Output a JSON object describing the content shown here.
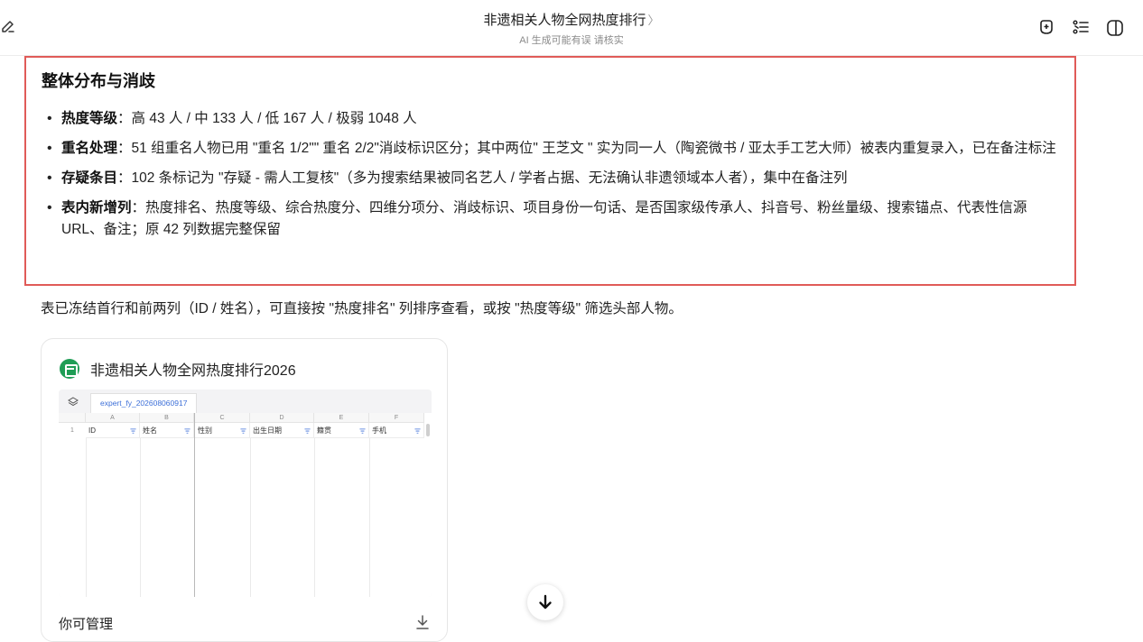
{
  "header": {
    "title": "非遗相关人物全网热度排行",
    "title_chevron": "〉",
    "subtitle": "AI 生成可能有误 请核实"
  },
  "icons": {
    "edit": "edit-icon",
    "new_chat": "new-chat-icon",
    "outline": "outline-icon",
    "sidebar": "sidebar-toggle-icon",
    "spreadsheet": "spreadsheet-file-icon",
    "layers": "layers-icon",
    "filter": "filter-icon",
    "download": "download-icon",
    "arrow_down": "arrow-down-icon"
  },
  "summary": {
    "title": "整体分布与消歧",
    "items": [
      {
        "label": "热度等级",
        "text": "：高 43 人 / 中 133 人 / 低 167 人 / 极弱 1048 人"
      },
      {
        "label": "重名处理",
        "text": "：51 组重名人物已用 \"重名 1/2\"\" 重名 2/2\"消歧标识区分；其中两位\" 王芝文 \" 实为同一人（陶瓷微书 / 亚太手工艺大师）被表内重复录入，已在备注标注"
      },
      {
        "label": "存疑条目",
        "text": "：102 条标记为 \"存疑 - 需人工复核\"（多为搜索结果被同名艺人 / 学者占据、无法确认非遗领域本人者），集中在备注列"
      },
      {
        "label": "表内新增列",
        "text": "：热度排名、热度等级、综合热度分、四维分项分、消歧标识、项目身份一句话、是否国家级传承人、抖音号、粉丝量级、搜索锚点、代表性信源 URL、备注；原 42 列数据完整保留"
      }
    ]
  },
  "note": "表已冻结首行和前两列（ID / 姓名），可直接按 \"热度排名\" 列排序查看，或按 \"热度等级\" 筛选头部人物。",
  "card": {
    "title": "非遗相关人物全网热度排行2026",
    "sheet_tab": "expert_fy_202608060917",
    "columns": [
      "A",
      "B",
      "C",
      "D",
      "E",
      "F"
    ],
    "row_number": "1",
    "headers": [
      "ID",
      "姓名",
      "性别",
      "出生日期",
      "籍贯",
      "手机"
    ],
    "footer": "你可管理"
  },
  "colors": {
    "highlight_border": "#e05b58",
    "sheet_tab_text": "#3c6fd8",
    "file_icon": "#1f9d55"
  }
}
